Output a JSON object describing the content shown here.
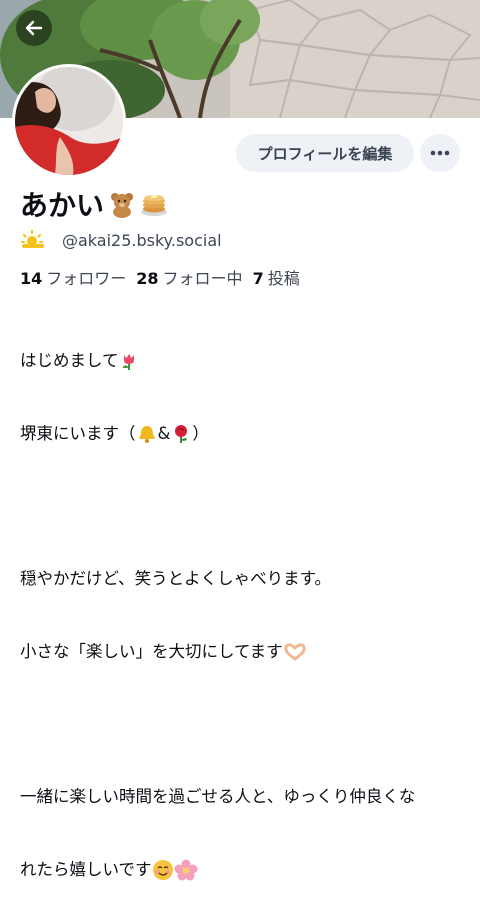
{
  "header": {
    "back_icon": "arrow-left-icon"
  },
  "profile": {
    "display_name": "あかい",
    "name_emojis": [
      "teddy-bear-icon",
      "pancakes-icon"
    ],
    "handle_icon": "sun-behind-cloud-icon",
    "handle": "@akai25.bsky.social",
    "edit_button_label": "プロフィールを編集",
    "more_icon": "ellipsis-icon"
  },
  "stats": {
    "followers_count": "14",
    "followers_label": "フォロワー",
    "following_count": "28",
    "following_label": "フォロー中",
    "posts_count": "7",
    "posts_label": "投稿"
  },
  "bio": {
    "line1": "はじめまして",
    "line2_a": "堺東にいます（",
    "line2_b": "&",
    "line2_c": "）",
    "line3": "穏やかだけど、笑うとよくしゃべります。",
    "line4": "小さな「楽しい」を大切にしてます",
    "line5": "一緒に楽しい時間を過ごせる人と、ゆっくり仲良くな",
    "line6": "れたら嬉しいです",
    "emoji_icons": [
      "tulip-icon",
      "bell-icon",
      "rose-icon",
      "heart-hands-icon",
      "smiling-face-icon",
      "cherry-blossom-icon"
    ]
  },
  "colors": {
    "button_bg": "#eef1f5",
    "secondary_text": "#3d4754",
    "primary_text": "#0b0f14"
  }
}
